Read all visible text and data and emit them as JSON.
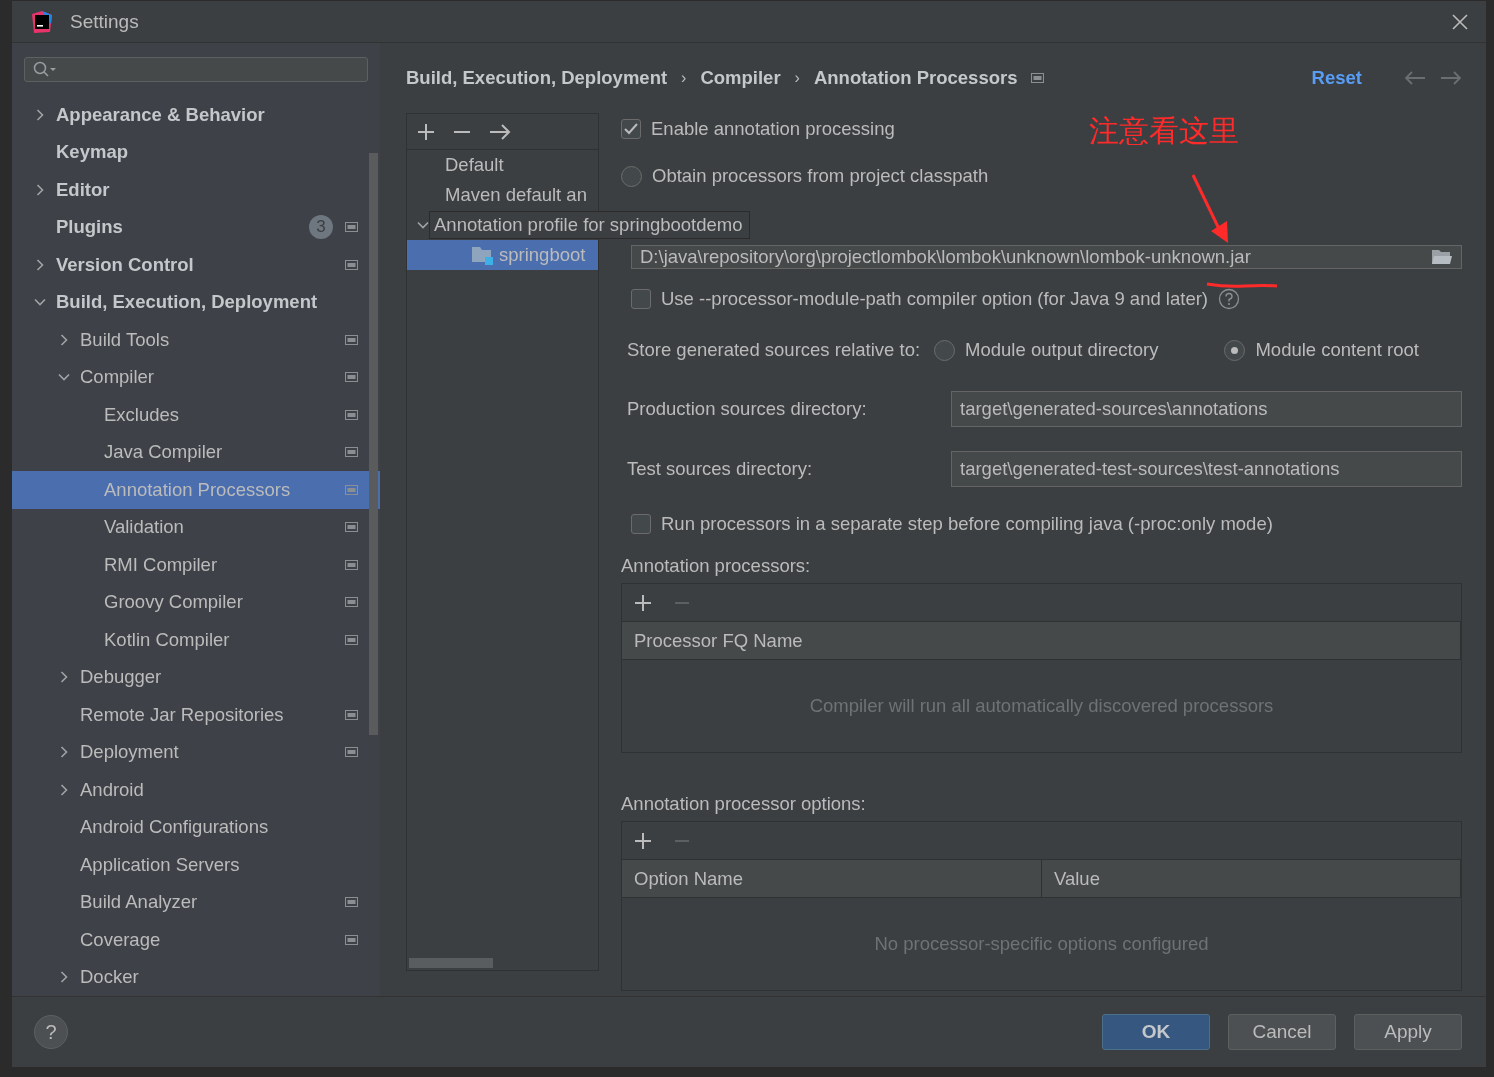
{
  "window": {
    "title": "Settings"
  },
  "sidebar": {
    "items": [
      {
        "label": "Appearance & Behavior",
        "expanded": false,
        "scoped": false,
        "selected": false
      },
      {
        "label": "Keymap",
        "scoped": false,
        "selected": false
      },
      {
        "label": "Editor",
        "expanded": false,
        "scoped": false,
        "selected": false
      },
      {
        "label": "Plugins",
        "badge": "3",
        "scoped": true,
        "selected": false
      },
      {
        "label": "Version Control",
        "expanded": false,
        "scoped": true,
        "selected": false
      },
      {
        "label": "Build, Execution, Deployment",
        "expanded": true,
        "scoped": false,
        "selected": false,
        "children": [
          {
            "label": "Build Tools",
            "expanded": false,
            "scoped": true,
            "selected": false
          },
          {
            "label": "Compiler",
            "expanded": true,
            "scoped": true,
            "selected": false,
            "children": [
              {
                "label": "Excludes",
                "scoped": true,
                "selected": false
              },
              {
                "label": "Java Compiler",
                "scoped": true,
                "selected": false
              },
              {
                "label": "Annotation Processors",
                "scoped": true,
                "selected": true
              },
              {
                "label": "Validation",
                "scoped": true,
                "selected": false
              },
              {
                "label": "RMI Compiler",
                "scoped": true,
                "selected": false
              },
              {
                "label": "Groovy Compiler",
                "scoped": true,
                "selected": false
              },
              {
                "label": "Kotlin Compiler",
                "scoped": true,
                "selected": false
              }
            ]
          },
          {
            "label": "Debugger",
            "expanded": false,
            "scoped": false,
            "selected": false
          },
          {
            "label": "Remote Jar Repositories",
            "scoped": true,
            "selected": false
          },
          {
            "label": "Deployment",
            "expanded": false,
            "scoped": true,
            "selected": false
          },
          {
            "label": "Android",
            "expanded": false,
            "scoped": false,
            "selected": false
          },
          {
            "label": "Android Configurations",
            "scoped": false,
            "selected": false
          },
          {
            "label": "Application Servers",
            "scoped": false,
            "selected": false
          },
          {
            "label": "Build Analyzer",
            "scoped": true,
            "selected": false
          },
          {
            "label": "Coverage",
            "scoped": true,
            "selected": false
          },
          {
            "label": "Docker",
            "expanded": false,
            "scoped": false,
            "selected": false
          }
        ]
      }
    ]
  },
  "breadcrumb": [
    "Build, Execution, Deployment",
    "Compiler",
    "Annotation Processors"
  ],
  "breadcrumb_separator": "›",
  "reset": "Reset",
  "profiles": [
    {
      "label": "Default",
      "selected": false
    },
    {
      "label": "Maven default an",
      "selected": false
    },
    {
      "label": "Annotation profile for springbootdemo",
      "expanded": true,
      "selected": false,
      "children": [
        {
          "label": "springboot",
          "selected": true
        }
      ]
    }
  ],
  "enable_processing": {
    "label": "Enable annotation processing",
    "checked": true
  },
  "obtain_radio": {
    "label": "Obtain processors from project classpath",
    "selected": false
  },
  "processor_path": {
    "value": "D:\\java\\repository\\org\\projectlombok\\lombok\\unknown\\lombok-unknown.jar"
  },
  "module_path": {
    "label": "Use --processor-module-path compiler option (for Java 9 and later)",
    "checked": false
  },
  "store": {
    "label": "Store generated sources relative to:",
    "options": [
      {
        "label": "Module output directory",
        "selected": false
      },
      {
        "label": "Module content root",
        "selected": true
      }
    ]
  },
  "directories": [
    {
      "label": "Production sources directory:",
      "value": "target\\generated-sources\\annotations"
    },
    {
      "label": "Test sources directory:",
      "value": "target\\generated-test-sources\\test-annotations"
    }
  ],
  "run_separately": {
    "label": "Run processors in a separate step before compiling java (-proc:only mode)",
    "checked": false
  },
  "processors_table": {
    "title": "Annotation processors:",
    "columns": [
      "Processor FQ Name"
    ],
    "empty": "Compiler will run all automatically discovered processors"
  },
  "options_table": {
    "title": "Annotation processor options:",
    "columns": [
      "Option Name",
      "Value"
    ],
    "empty": "No processor-specific options configured"
  },
  "annotation": {
    "text": "注意看这里"
  },
  "buttons": [
    {
      "label": "OK",
      "default": true
    },
    {
      "label": "Cancel",
      "default": false
    },
    {
      "label": "Apply",
      "default": false
    }
  ],
  "help": "?"
}
